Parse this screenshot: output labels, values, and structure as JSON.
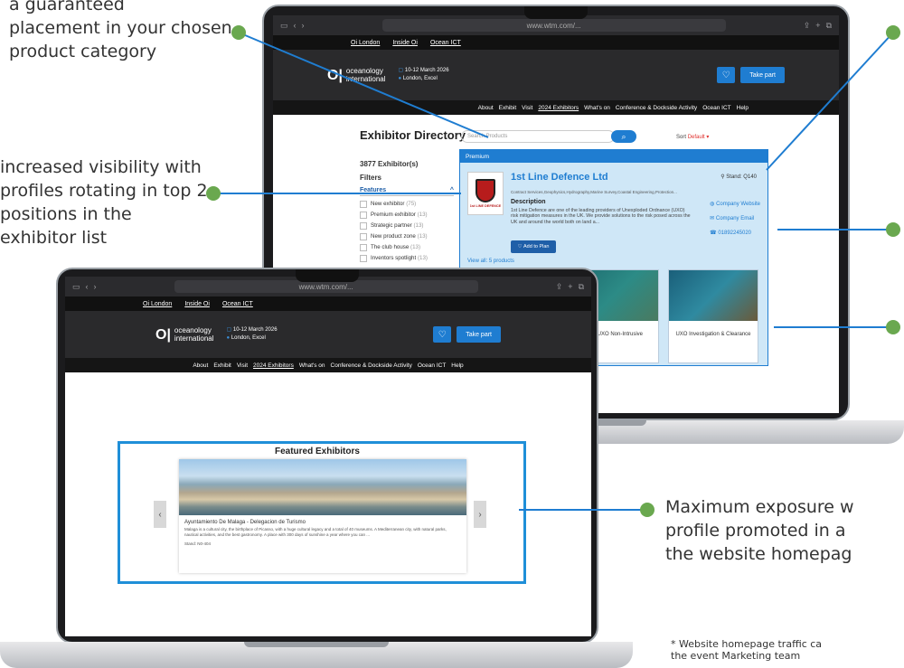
{
  "annotations": {
    "placement": [
      "a guaranteed",
      "placement in your chosen",
      "product category"
    ],
    "visibility": [
      "increased visibility with",
      "profiles rotating in top 2",
      "positions in the",
      "exhibitor list"
    ],
    "exposure": [
      "Maximum exposure w",
      "profile promoted in a",
      "the website homepag"
    ],
    "footnote": [
      "* Website homepage traffic ca",
      "the event Marketing team"
    ]
  },
  "browser": {
    "url": "www.wtm.com/...",
    "url2": "www.wtm.com/..."
  },
  "site": {
    "toplinks": [
      "Oi London",
      "Inside Oi",
      "Ocean ICT"
    ],
    "logo_top": "oceanology",
    "logo_bottom": "international",
    "date": "10-12 March 2026",
    "location": "London, Excel",
    "take_part": "Take part",
    "nav": [
      "About",
      "Exhibit",
      "Visit",
      "2024 Exhibitors",
      "What's on",
      "Conference & Dockside Activity",
      "Ocean ICT",
      "Help"
    ]
  },
  "directory": {
    "title": "Exhibitor Directory",
    "search_placeholder": "Search Products",
    "sort_label": "Sort",
    "sort_value": "Default",
    "count": "3877 Exhibitor(s)",
    "filters": "Filters",
    "features": "Features",
    "options": [
      {
        "label": "New exhibitor",
        "count": "(75)"
      },
      {
        "label": "Premium exhibitor",
        "count": "(13)"
      },
      {
        "label": "Strategic partner",
        "count": "(13)"
      },
      {
        "label": "New product zone",
        "count": "(13)"
      },
      {
        "label": "The club house",
        "count": "(13)"
      },
      {
        "label": "Inventors spotlight",
        "count": "(13)"
      }
    ]
  },
  "premium_card": {
    "badge": "Premium",
    "name": "1st Line Defence Ltd",
    "stand": "Stand: Q140",
    "categories": "Contract Services,Geophysics,Hydrography,Marine Survey,Coastal Engineering,Protection...",
    "desc_heading": "Description",
    "description": "1st Line Defence are one of the leading providers of Unexploded Ordnance (UXO) risk mitigation measures in the UK. We provide solutions to the risk posed across the UK and around the world both on land a...",
    "website": "Company Website",
    "email": "Company Email",
    "phone": "01892245020",
    "add_to_plan": "Add to Plan",
    "view_all": "View all: 5 products",
    "logo_text": "1st LINE DEFENCE",
    "products": [
      "sical UXO Non-Intrusive",
      "UXO Investigation & Clearance"
    ]
  },
  "featured": {
    "title": "Featured Exhibitors",
    "name": "Ayuntamiento De Malaga - Delegacion de Turismo",
    "description": "Malaga is a cultural city, the birthplace of Picasso, with a huge cultural legacy and a total of 40 museums. A Mediterranean city, with natural parks, nautical activities, and the best gastronomy. A place with 300 days of sunshine a year where you can ...",
    "stand": "Stand: N0-404"
  },
  "colors": {
    "accent": "#1f7dd1",
    "dot": "#6aa84f"
  }
}
